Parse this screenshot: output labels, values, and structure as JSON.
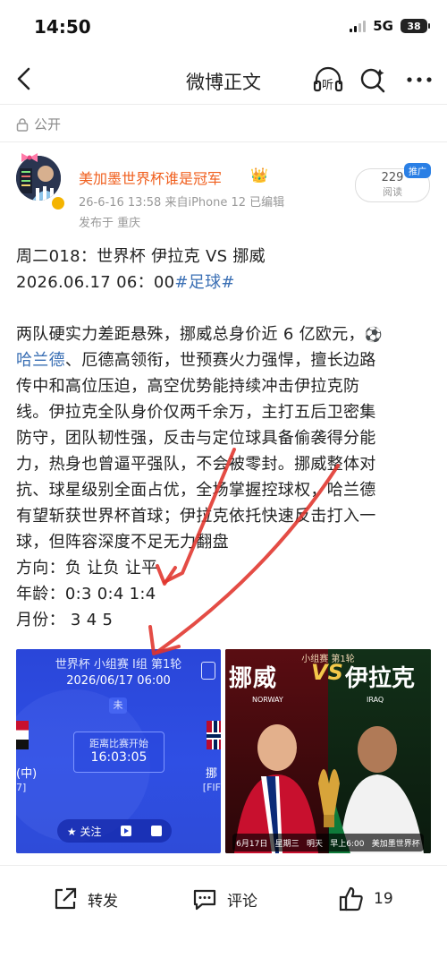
{
  "status": {
    "time": "14:50",
    "network": "5G",
    "battery": "38"
  },
  "nav": {
    "title": "微博正文",
    "listen_label": "听"
  },
  "visibility": "公开",
  "author": {
    "name": "美加墨世界杯谁是冠军",
    "meta": "26-6-16 13:58  来自iPhone 12  已编辑",
    "location": "发布于 重庆",
    "reads": "229",
    "reads_label": "阅读",
    "promo": "推广"
  },
  "post": {
    "line1": "周二018：世界杯   伊拉克 VS 挪威",
    "line2": "2026.06.17    06：00",
    "hashtag": "#足球#",
    "p1_a": "两队硬实力差距悬殊，挪威总身价近 6 亿欧元，",
    "p1_link": "哈兰德",
    "p1_b": "、厄德高领衔，世预赛火力强悍，擅长边路",
    "p2": "传中和高位压迫，高空优势能持续冲击伊拉克防",
    "p3": "线。伊拉克全队身价仅两千余万，主打五后卫密集",
    "p4": "防守，团队韧性强，反击与定位球具备偷袭得分能",
    "p5": "力，热身也曾逼平强队，不会被零封。挪威整体对",
    "p6": "抗、球星级别全面占优，全场掌握控球权，哈兰德",
    "p7": "有望斩获世界杯首球；伊拉克依托快速反击打入一",
    "p8": "球，但阵容深度不足无力翻盘",
    "dir": "方向：负   让负   让平",
    "age": "年龄：0:3   0:4   1:4",
    "month": "月份：  3      4      5"
  },
  "card1": {
    "title": "世界杯 小组赛 I组 第1轮",
    "date": "2026/06/17 06:00",
    "status": "未",
    "countdown_label": "距离比赛开始",
    "countdown": "16:03:05",
    "left_team": "(中)",
    "left_sub": "7]",
    "right_team": "挪",
    "right_sub": "[FIF",
    "follow": "关注"
  },
  "card2": {
    "title": "小组赛 第1轮",
    "home": "挪威",
    "vs": "VS",
    "away": "伊拉克",
    "home_en": "NORWAY",
    "away_en": "IRAQ",
    "date": "6月17日",
    "weekday": "星期三",
    "day": "明天",
    "time": "早上6:00",
    "league": "美加墨世界杯",
    "stage": "小组赛"
  },
  "actions": {
    "forward": "转发",
    "comment": "评论",
    "likes": "19"
  },
  "colors": {
    "accent": "#f05f1e",
    "link": "#3a6fb4",
    "card_blue": "#2f4fe4",
    "annotation_red": "#e0332b"
  }
}
